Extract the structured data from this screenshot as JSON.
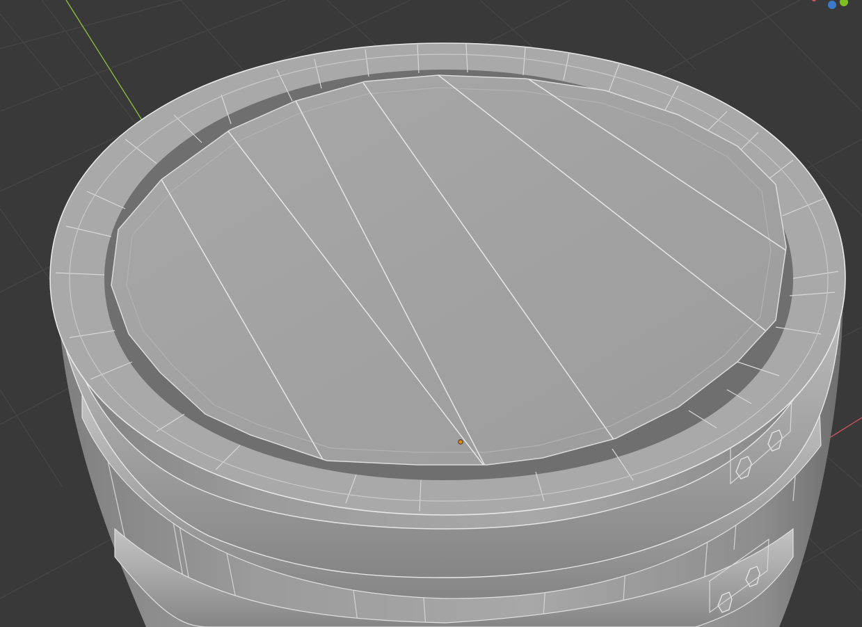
{
  "viewport": {
    "background": "#393939",
    "grid_color": "#454545",
    "y_axis_color": "#8fc23a",
    "x_axis_color": "#d8545f",
    "origin_color": "#e08a12"
  },
  "model": {
    "name": "barrel",
    "shading": "solid",
    "base_color": "#a4a4a4",
    "lid_color": "#a2a2a2",
    "edge_color": "#e0e0e0"
  },
  "gizmo": {
    "icons": [
      "z-axis-gizmo-icon",
      "y-axis-gizmo-icon"
    ]
  }
}
